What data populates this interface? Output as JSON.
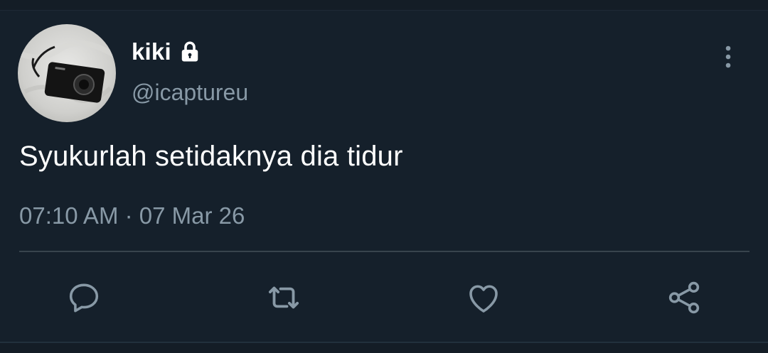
{
  "tweet": {
    "author_name": "kiki",
    "handle": "@icaptureu",
    "text": "Syukurlah setidaknya dia tidur",
    "time": "07:10 AM",
    "separator": "·",
    "date": "07 Mar 26",
    "protected": true
  },
  "icons": {
    "avatar": "camera-photo-avatar",
    "lock": "lock-icon",
    "more": "more-vertical-icon",
    "reply": "reply-icon",
    "retweet": "retweet-icon",
    "like": "like-icon",
    "share": "share-icon"
  },
  "colors": {
    "background": "#15202b",
    "text_primary": "#ffffff",
    "text_secondary": "#8899a6",
    "icon": "#8899a6",
    "divider": "#38444d"
  }
}
